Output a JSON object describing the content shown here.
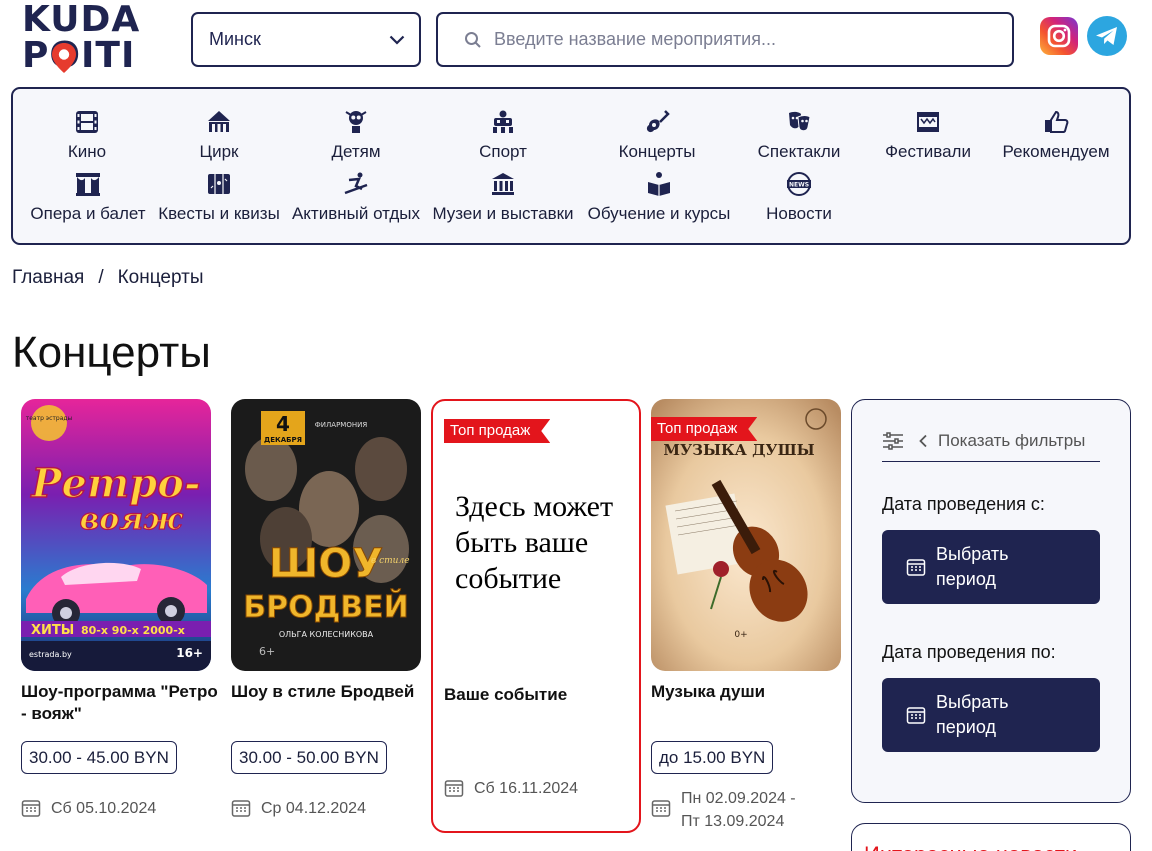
{
  "header": {
    "logo_line1": "KUDA",
    "logo_line2": "POITI",
    "city": "Минск",
    "search_placeholder": "Введите название мероприятия...",
    "social": [
      "instagram-icon",
      "telegram-icon"
    ]
  },
  "categories": [
    {
      "label": "Кино",
      "icon": "film-icon"
    },
    {
      "label": "Цирк",
      "icon": "circus-tent-icon"
    },
    {
      "label": "Детям",
      "icon": "kids-icon"
    },
    {
      "label": "Спорт",
      "icon": "stadium-icon"
    },
    {
      "label": "Концерты",
      "icon": "guitar-icon"
    },
    {
      "label": "Спектакли",
      "icon": "theatre-masks-icon"
    },
    {
      "label": "Фестивали",
      "icon": "festival-icon"
    },
    {
      "label": "Рекомендуем",
      "icon": "thumbs-up-icon"
    },
    {
      "label": "Опера и балет",
      "icon": "opera-stage-icon"
    },
    {
      "label": "Квесты и квизы",
      "icon": "map-icon"
    },
    {
      "label": "Активный отдых",
      "icon": "snowboard-icon"
    },
    {
      "label": "Музеи и выставки",
      "icon": "museum-icon"
    },
    {
      "label": "Обучение и курсы",
      "icon": "reading-person-icon"
    },
    {
      "label": "Новости",
      "icon": "news-globe-icon"
    }
  ],
  "breadcrumb": {
    "home": "Главная",
    "separator": "/",
    "current": "Концерты"
  },
  "page_title": "Концерты",
  "cards": [
    {
      "name": "Шоу-программа \"Ретро - вояж\"",
      "price": "30.00 - 45.00 BYN",
      "date": "Сб 05.10.2024",
      "poster": {
        "top": "театр эстрады",
        "title1": "Ретро-",
        "title2": "вояж",
        "hits": "ХИТЫ",
        "decades": "80-х 90-х 2000-х",
        "site": "estrada.by",
        "age": "16+"
      }
    },
    {
      "name": "Шоу в стиле Бродвей",
      "price": "30.00 - 50.00 BYN",
      "date": "Ср 04.12.2024",
      "poster": {
        "day": "4",
        "month": "ДЕКАБРЯ",
        "org": "ФИЛАРМОНИЯ",
        "title1": "ШОУ",
        "title2": "БРОДВЕЙ",
        "subtitle": "в стиле",
        "artist": "ОЛЬГА КОЛЕСНИКОВА",
        "age": "6+"
      }
    },
    {
      "badge": "Топ продаж",
      "promo_text": "Здесь может быть ваше событие",
      "name": "Ваше событие",
      "date": "Сб 16.11.2024"
    },
    {
      "badge": "Топ продаж",
      "name": "Музыка души",
      "price": "до 15.00 BYN",
      "date_from": "Пн 02.09.2024 -",
      "date_to": "Пт 13.09.2024",
      "poster": {
        "title": "МУЗЫКА ДУШЫ",
        "age": "0+"
      }
    }
  ],
  "filters": {
    "toggle_label": "Показать фильтры",
    "date_from_label": "Дата проведения с:",
    "date_to_label": "Дата проведения по:",
    "period_button": "Выбрать период"
  },
  "news_box_title": "Интересные новости",
  "colors": {
    "navy": "#1f2450",
    "red": "#e3151c",
    "panel": "#f6f7fb"
  }
}
